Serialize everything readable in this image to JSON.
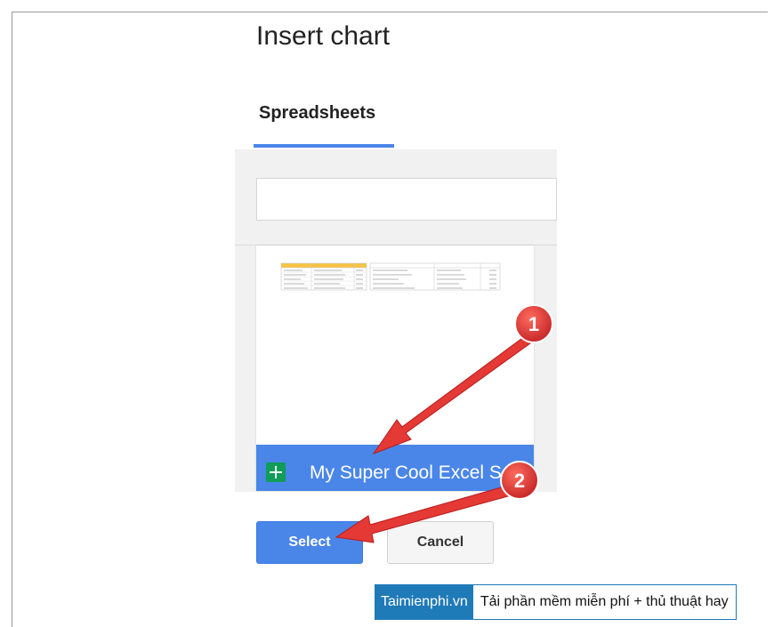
{
  "dialog": {
    "title": "Insert chart",
    "tabs": [
      {
        "label": "Spreadsheets",
        "active": true
      }
    ],
    "search": {
      "placeholder": ""
    },
    "file": {
      "name": "My Super Cool Excel S",
      "icon": "google-sheets-icon"
    },
    "buttons": {
      "select": "Select",
      "cancel": "Cancel"
    }
  },
  "thumbnail": {
    "left_headers": [
      "Title",
      "Director",
      "Year"
    ],
    "right_headers": [
      "Title",
      "Director",
      "Year"
    ],
    "rows": 6
  },
  "callouts": [
    {
      "number": "1"
    },
    {
      "number": "2"
    }
  ],
  "watermark": {
    "brand": "Taimienphi.vn",
    "slogan": "Tải phần mềm miễn phí + thủ thuật hay"
  },
  "colors": {
    "accent": "#4a86e8",
    "sheets_green": "#0f9d58",
    "callout_red": "#e53935",
    "watermark_blue": "#1f7ab8"
  }
}
